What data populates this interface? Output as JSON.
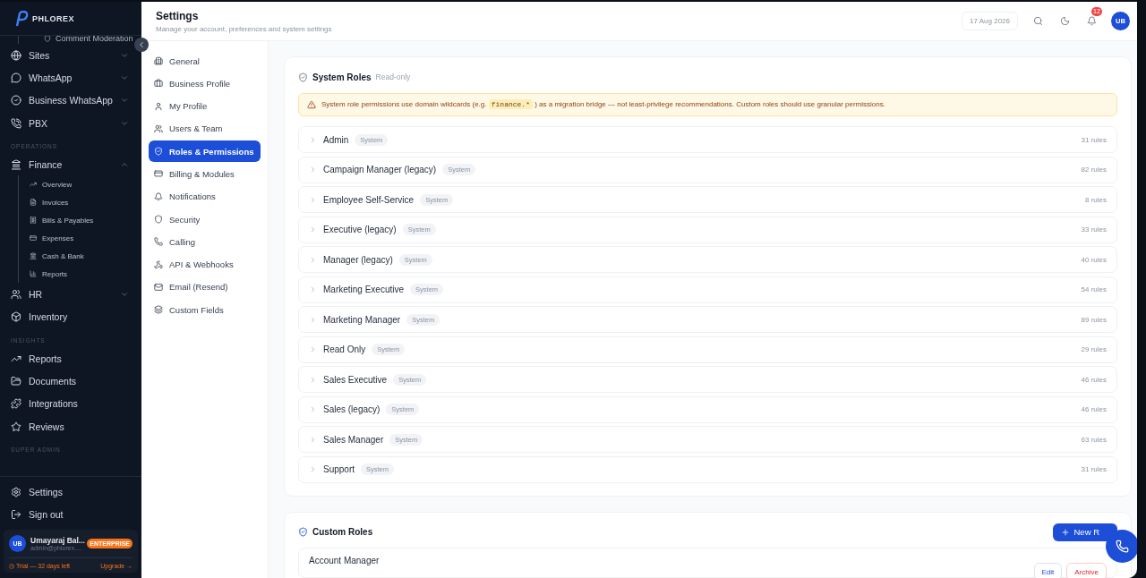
{
  "sidebar": {
    "logo": "PHLOREX",
    "items": [
      {
        "kind": "sub",
        "label": "Comment Moderation"
      },
      {
        "kind": "item",
        "label": "Sites",
        "expanded": false
      },
      {
        "kind": "item",
        "label": "WhatsApp",
        "expanded": false
      },
      {
        "kind": "item",
        "label": "Business WhatsApp",
        "expanded": false
      },
      {
        "kind": "item",
        "label": "PBX",
        "expanded": false
      },
      {
        "kind": "section",
        "label": "OPERATIONS"
      },
      {
        "kind": "item",
        "label": "Finance",
        "expanded": true,
        "children": [
          {
            "label": "Overview"
          },
          {
            "label": "Invoices"
          },
          {
            "label": "Bills & Payables"
          },
          {
            "label": "Expenses"
          },
          {
            "label": "Cash & Bank"
          },
          {
            "label": "Reports"
          }
        ]
      },
      {
        "kind": "item",
        "label": "HR",
        "expanded": false
      },
      {
        "kind": "item",
        "label": "Inventory"
      },
      {
        "kind": "section",
        "label": "INSIGHTS"
      },
      {
        "kind": "item",
        "label": "Reports"
      },
      {
        "kind": "item",
        "label": "Documents"
      },
      {
        "kind": "item",
        "label": "Integrations"
      },
      {
        "kind": "item",
        "label": "Reviews"
      },
      {
        "kind": "section",
        "label": "SUPER ADMIN"
      }
    ],
    "footer": [
      {
        "label": "Settings"
      },
      {
        "label": "Sign out"
      }
    ],
    "user": {
      "initials": "UB",
      "name": "Umayaraj Bal...",
      "email": "admin@phlorex....",
      "plan": "ENTERPRISE",
      "trial": "Trial — 32 days left",
      "upgrade": "Upgrade →"
    }
  },
  "header": {
    "title": "Settings",
    "subtitle": "Manage your account, preferences and system settings",
    "date": "17 Aug 2026",
    "notifications": "12",
    "avatar": "UB"
  },
  "settings_nav": [
    {
      "label": "General",
      "selected": false
    },
    {
      "label": "Business Profile",
      "selected": false
    },
    {
      "label": "My Profile",
      "selected": false
    },
    {
      "label": "Users & Team",
      "selected": false
    },
    {
      "label": "Roles & Permissions",
      "selected": true
    },
    {
      "label": "Billing & Modules",
      "selected": false
    },
    {
      "label": "Notifications",
      "selected": false
    },
    {
      "label": "Security",
      "selected": false
    },
    {
      "label": "Calling",
      "selected": false
    },
    {
      "label": "API & Webhooks",
      "selected": false
    },
    {
      "label": "Email (Resend)",
      "selected": false
    },
    {
      "label": "Custom Fields",
      "selected": false
    }
  ],
  "system_roles": {
    "title": "System Roles",
    "note": "Read-only",
    "warning": {
      "before": "System role permissions use domain wildcards (e.g.",
      "code": "finance.*",
      "after": ") as a migration bridge — not least-privilege recommendations. Custom roles should use granular permissions."
    },
    "rows": [
      {
        "name": "Admin",
        "badge": "System",
        "rules": "31 rules",
        "expanded": false
      },
      {
        "name": "Campaign Manager (legacy)",
        "badge": "System",
        "rules": "82 rules",
        "expanded": false
      },
      {
        "name": "Employee Self-Service",
        "badge": "System",
        "rules": "8 rules",
        "expanded": false
      },
      {
        "name": "Executive (legacy)",
        "badge": "System",
        "rules": "33 rules",
        "expanded": false
      },
      {
        "name": "Manager (legacy)",
        "badge": "System",
        "rules": "40 rules",
        "expanded": false
      },
      {
        "name": "Marketing Executive",
        "badge": "System",
        "rules": "54 rules",
        "expanded": false
      },
      {
        "name": "Marketing Manager",
        "badge": "System",
        "rules": "89 rules",
        "expanded": false
      },
      {
        "name": "Read Only",
        "badge": "System",
        "rules": "29 rules",
        "expanded": false
      },
      {
        "name": "Sales Executive",
        "badge": "System",
        "rules": "46 rules",
        "expanded": false
      },
      {
        "name": "Sales (legacy)",
        "badge": "System",
        "rules": "46 rules",
        "expanded": false
      },
      {
        "name": "Sales Manager",
        "badge": "System",
        "rules": "63 rules",
        "expanded": false
      },
      {
        "name": "Support",
        "badge": "System",
        "rules": "31 rules",
        "expanded": false
      }
    ]
  },
  "custom_roles": {
    "title": "Custom Roles",
    "new_button": "New R",
    "rows": [
      {
        "name": "Account Manager",
        "edit": "Edit",
        "archive": "Archive"
      }
    ]
  }
}
